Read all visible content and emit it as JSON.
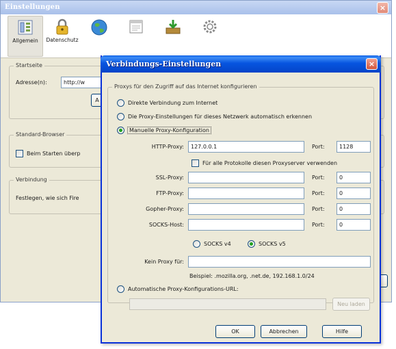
{
  "background_window": {
    "title": "Einstellungen",
    "close_symbol": "×",
    "toolbar": [
      {
        "label": "Allgemein",
        "icon": "general-icon",
        "selected": true
      },
      {
        "label": "Datenschutz",
        "icon": "privacy-lock-icon",
        "selected": false
      },
      {
        "label": "",
        "icon": "web-features-globe-icon",
        "selected": false
      },
      {
        "label": "",
        "icon": "downloads-window-icon",
        "selected": false
      },
      {
        "label": "",
        "icon": "downloads-tray-icon",
        "selected": false
      },
      {
        "label": "",
        "icon": "advanced-gear-icon",
        "selected": false
      }
    ],
    "startseite": {
      "title": "Startseite",
      "address_label": "Adresse(n):",
      "address_value": "http://w",
      "button_label": "A"
    },
    "standard_browser": {
      "title": "Standard-Browser",
      "checkbox_label": "Beim Starten überp"
    },
    "verbindung": {
      "title": "Verbindung",
      "text": "Festlegen, wie sich Fire"
    }
  },
  "dialog": {
    "title": "Verbindungs-Einstellungen",
    "close_symbol": "×",
    "group_title": "Proxys für den Zugriff auf das Internet konfigurieren",
    "options": {
      "direct": "Direkte Verbindung zum Internet",
      "auto_detect": "Die Proxy-Einstellungen für dieses Netzwerk automatisch erkennen",
      "manual": "Manuelle Proxy-Konfiguration",
      "auto_url": "Automatische Proxy-Konfigurations-URL:"
    },
    "selected_option": "manual",
    "http_proxy": {
      "label": "HTTP-Proxy:",
      "value": "127.0.0.1",
      "port_label": "Port:",
      "port": "1128"
    },
    "same_proxy_checkbox": "Für alle Protokolle diesen Proxyserver verwenden",
    "ssl_proxy": {
      "label": "SSL-Proxy:",
      "value": "",
      "port_label": "Port:",
      "port": "0"
    },
    "ftp_proxy": {
      "label": "FTP-Proxy:",
      "value": "",
      "port_label": "Port:",
      "port": "0"
    },
    "gopher_proxy": {
      "label": "Gopher-Proxy:",
      "value": "",
      "port_label": "Port:",
      "port": "0"
    },
    "socks_host": {
      "label": "SOCKS-Host:",
      "value": "",
      "port_label": "Port:",
      "port": "0"
    },
    "socks_v4": "SOCKS v4",
    "socks_v5": "SOCKS v5",
    "socks_selected": "v5",
    "no_proxy": {
      "label": "Kein Proxy für:",
      "value": ""
    },
    "example": "Beispiel: .mozilla.org, .net.de, 192.168.1.0/24",
    "auto_url_value": "",
    "reload_button": "Neu laden",
    "buttons": {
      "ok": "OK",
      "cancel": "Abbrechen",
      "help": "Hilfe"
    }
  },
  "colors": {
    "titlebar_blue": "#0755e0",
    "window_face": "#ece9d8",
    "close_red": "#d2563c",
    "radio_green": "#21a121"
  }
}
